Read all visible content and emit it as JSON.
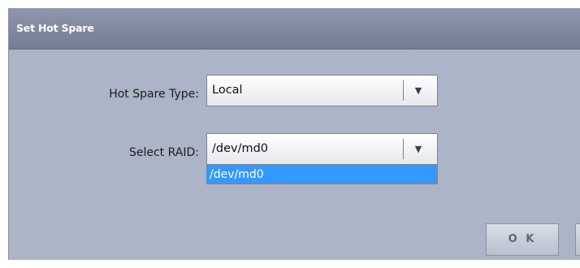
{
  "dialog": {
    "title": "Set Hot Spare"
  },
  "fields": {
    "hot_spare_type": {
      "label": "Hot Spare Type:",
      "value": "Local"
    },
    "select_raid": {
      "label": "Select RAID:",
      "value": "/dev/md0",
      "options": [
        "/dev/md0"
      ]
    }
  },
  "buttons": {
    "ok_label": "O K"
  },
  "icons": {
    "dropdown_arrow": "triangle-down"
  },
  "colors": {
    "dialog_bg": "#acb5c8",
    "titlebar": "#7d869b",
    "selected_option": "#3399ff"
  }
}
